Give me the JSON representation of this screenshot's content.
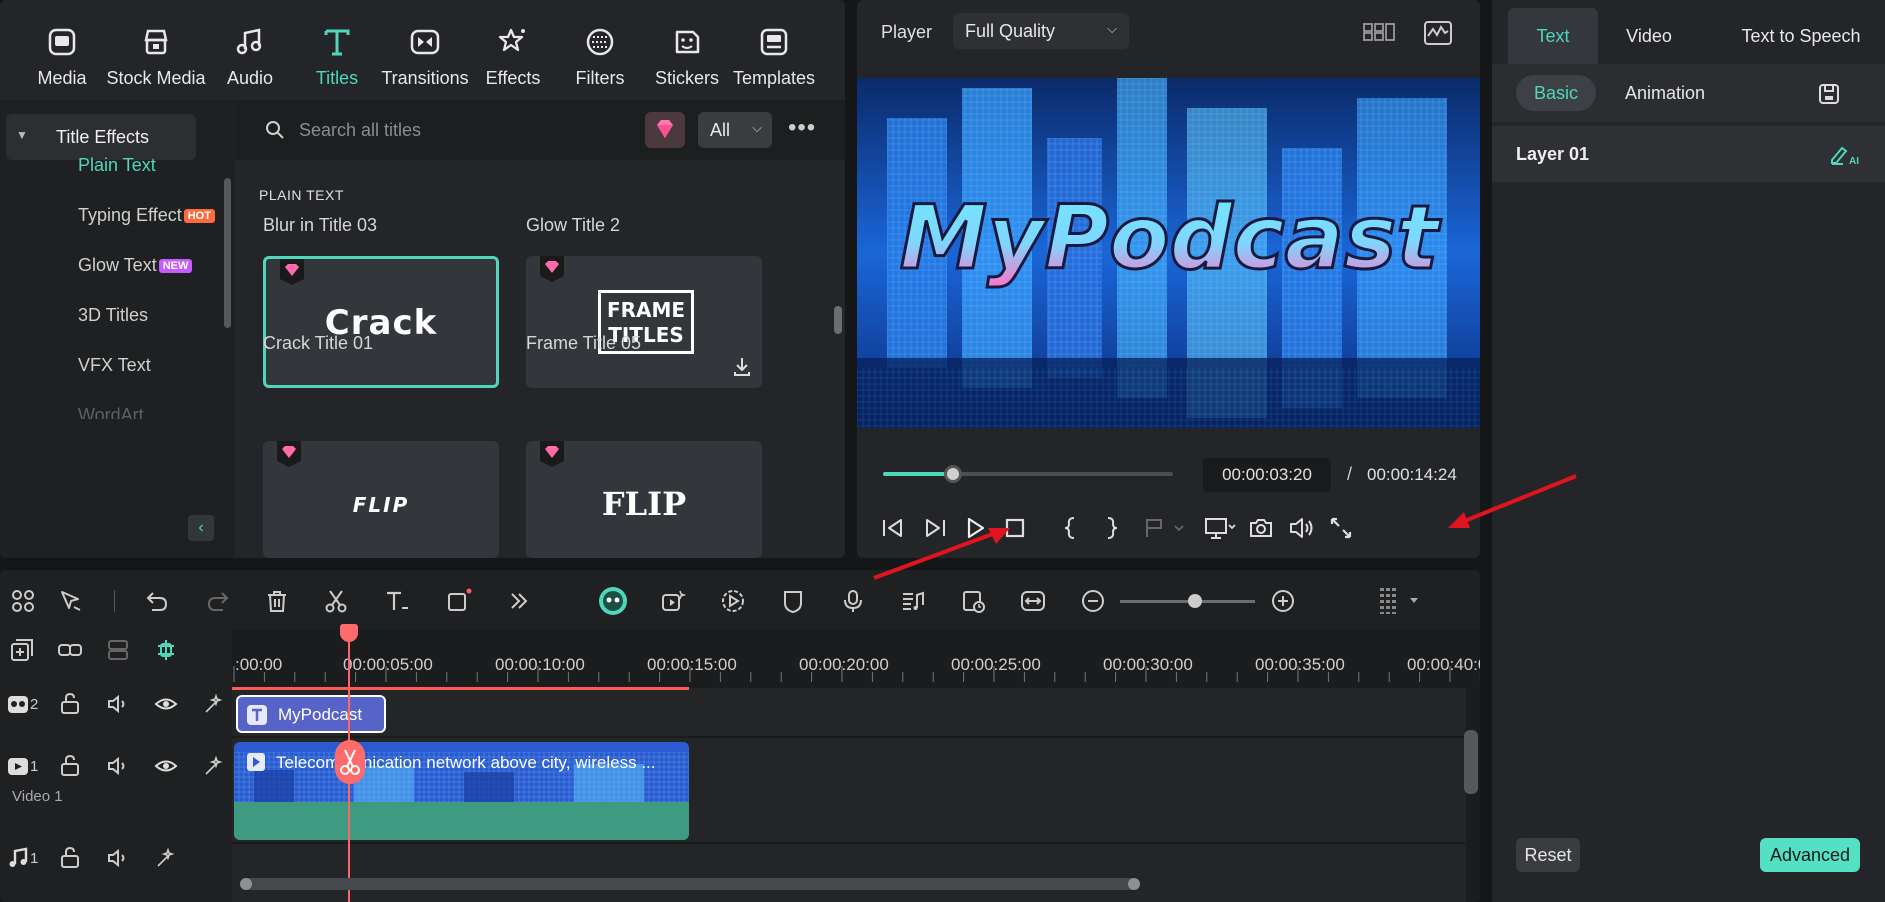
{
  "categories": [
    {
      "label": "Media",
      "icon": "media-icon"
    },
    {
      "label": "Stock Media",
      "icon": "stock-media-icon"
    },
    {
      "label": "Audio",
      "icon": "audio-icon"
    },
    {
      "label": "Titles",
      "icon": "titles-icon",
      "active": true
    },
    {
      "label": "Transitions",
      "icon": "transitions-icon"
    },
    {
      "label": "Effects",
      "icon": "effects-icon"
    },
    {
      "label": "Filters",
      "icon": "filters-icon"
    },
    {
      "label": "Stickers",
      "icon": "stickers-icon"
    },
    {
      "label": "Templates",
      "icon": "templates-icon"
    }
  ],
  "sidebar": {
    "header": "Title Effects",
    "items": [
      {
        "label": "Plain Text",
        "active": true
      },
      {
        "label": "Typing Effect",
        "badge": "HOT"
      },
      {
        "label": "Glow Text",
        "badge": "NEW"
      },
      {
        "label": "3D Titles"
      },
      {
        "label": "VFX Text"
      },
      {
        "label": "WordArt"
      }
    ]
  },
  "search": {
    "placeholder": "Search all titles",
    "filter": "All"
  },
  "section": "PLAIN TEXT",
  "cards": {
    "top_labels": [
      "Blur in Title 03",
      "Glow Title 2"
    ],
    "row1": [
      {
        "label": "Crack Title 01",
        "preview": "Crack",
        "selected": true
      },
      {
        "label": "Frame Title 05",
        "preview_line1": "FRAME",
        "preview_line2": "TITLES"
      }
    ],
    "row2": [
      {
        "preview": "FLIP"
      },
      {
        "preview": "FLIP"
      }
    ]
  },
  "player": {
    "label": "Player",
    "quality": "Full Quality",
    "overlay_text": "MyPodcast",
    "current_time": "00:00:03:20",
    "separator": "/",
    "total_time": "00:00:14:24",
    "progress": 0.24
  },
  "props": {
    "tabs": [
      "Text",
      "Video",
      "Text to Speech"
    ],
    "subtabs": [
      "Basic",
      "Animation"
    ],
    "layer": "Layer 01",
    "reset": "Reset",
    "advanced": "Advanced"
  },
  "timeline": {
    "ticks": [
      ":00:00",
      "00:00:05:00",
      "00:00:10:00",
      "00:00:15:00",
      "00:00:20:00",
      "00:00:25:00",
      "00:00:30:00",
      "00:00:35:00",
      "00:00:40:0"
    ],
    "tracks": [
      {
        "number": "2",
        "type": "title"
      },
      {
        "number": "1",
        "type": "video",
        "name": "Video 1"
      },
      {
        "number": "1",
        "type": "audio"
      }
    ],
    "title_clip": "MyPodcast",
    "video_clip": "Telecommunication network above city, wireless ..."
  },
  "colors": {
    "accent": "#4fd6bb",
    "playhead": "#ff6565",
    "title_clip": "#5863c8",
    "annotation_arrow": "#e0141e"
  }
}
